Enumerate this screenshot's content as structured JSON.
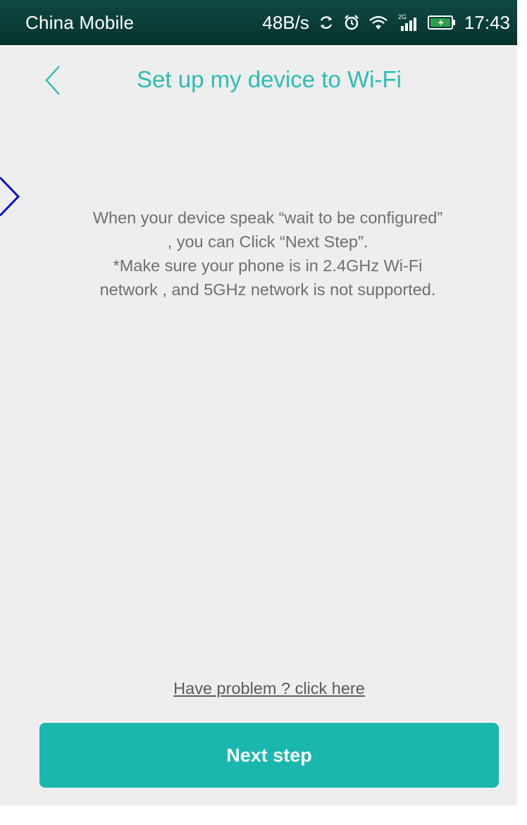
{
  "status_bar": {
    "carrier": "China Mobile",
    "network_speed": "48B/s",
    "icons": [
      "sync-icon",
      "alarm-icon",
      "wifi-icon",
      "cell-signal-icon",
      "battery-icon"
    ],
    "network_type": "2G",
    "time": "17:43"
  },
  "header": {
    "back_icon": "chevron-left-icon",
    "title": "Set up my device to Wi-Fi"
  },
  "instructions": {
    "paragraph1": "When your device speak “wait to be configured” , you can Click “Next Step”.",
    "paragraph2": "*Make sure your phone is in 2.4GHz Wi-Fi network , and 5GHz network is not supported."
  },
  "footer": {
    "help_link": "Have problem ? click here",
    "next_button": "Next step"
  },
  "colors": {
    "accent": "#2bbdb3",
    "button": "#19b7ad",
    "status_bar": "#0d4a43",
    "background": "#eeeeee",
    "annotation": "#1010c8"
  }
}
